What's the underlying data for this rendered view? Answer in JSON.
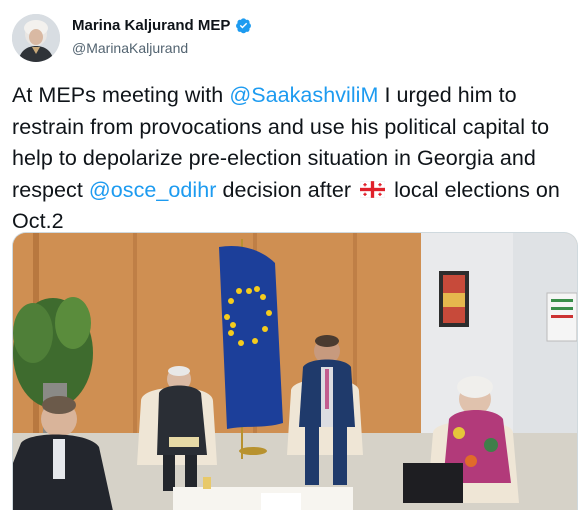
{
  "author": {
    "name": "Marina Kaljurand MEP",
    "handle": "@MarinaKaljurand",
    "verified": true
  },
  "tweet": {
    "text_1": "At MEPs meeting with ",
    "mention_1": "@SaakashviliM",
    "text_2": " I urged him to restrain from provocations and use his political capital to help to depolarize pre-election situation in Georgia and respect ",
    "mention_2": "@osce_odihr",
    "text_3": " decision after ",
    "text_4": " local elections on Oct.2",
    "flag_emoji": "flag-georgia"
  },
  "colors": {
    "link": "#1d9bf0",
    "verified": "#1d9bf0",
    "text": "#0f1419",
    "secondary": "#536471"
  }
}
